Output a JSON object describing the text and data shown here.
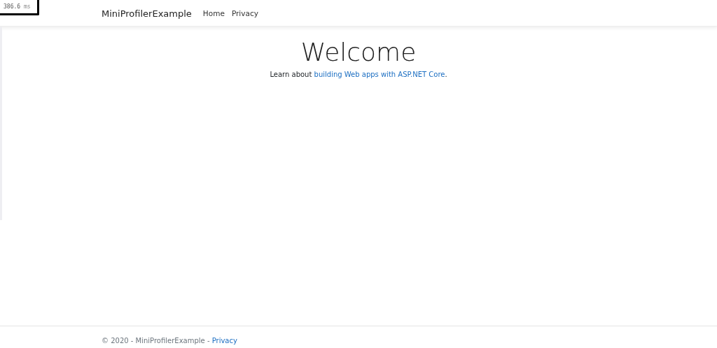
{
  "profiler": {
    "duration": "386.6",
    "unit": "ms"
  },
  "navbar": {
    "brand": "MiniProfilerExample",
    "links": [
      {
        "label": "Home"
      },
      {
        "label": "Privacy"
      }
    ]
  },
  "main": {
    "heading": "Welcome",
    "text_before": "Learn about ",
    "link": "building Web apps with ASP.NET Core",
    "text_after": "."
  },
  "footer": {
    "text": "© 2020 - MiniProfilerExample - ",
    "link": "Privacy"
  }
}
